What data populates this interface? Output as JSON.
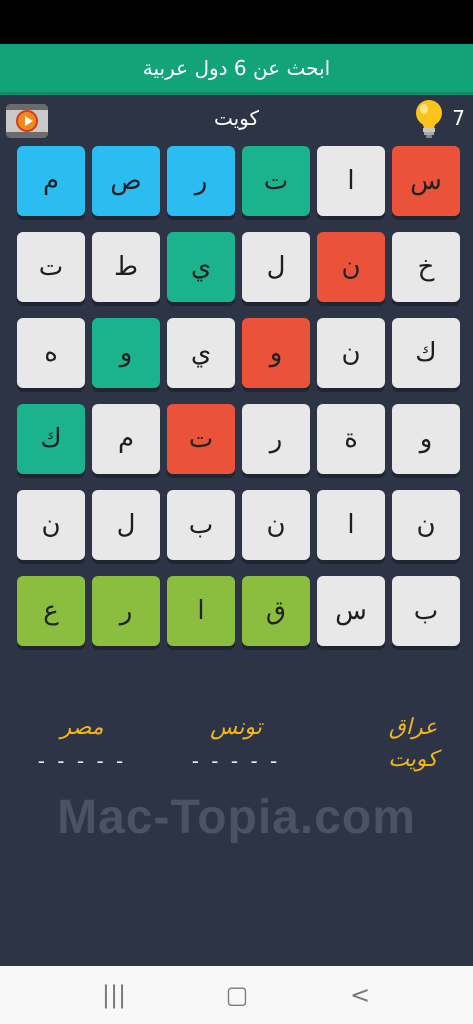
{
  "title": "ابحث عن 6 دول عربية",
  "toolbar": {
    "current_word": "كويت",
    "hint_count": "7",
    "video_icon": "video-play-icon",
    "hint_icon": "lightbulb-icon"
  },
  "grid": {
    "rows": [
      [
        {
          "letter": "س",
          "color": "red"
        },
        {
          "letter": "ا",
          "color": "white"
        },
        {
          "letter": "ت",
          "color": "teal"
        },
        {
          "letter": "ر",
          "color": "blue"
        },
        {
          "letter": "ص",
          "color": "blue"
        },
        {
          "letter": "م",
          "color": "blue"
        }
      ],
      [
        {
          "letter": "خ",
          "color": "white"
        },
        {
          "letter": "ن",
          "color": "red"
        },
        {
          "letter": "ل",
          "color": "white"
        },
        {
          "letter": "ي",
          "color": "teal"
        },
        {
          "letter": "ط",
          "color": "white"
        },
        {
          "letter": "ت",
          "color": "white"
        }
      ],
      [
        {
          "letter": "ك",
          "color": "white"
        },
        {
          "letter": "ن",
          "color": "white"
        },
        {
          "letter": "و",
          "color": "red"
        },
        {
          "letter": "ي",
          "color": "white"
        },
        {
          "letter": "و",
          "color": "teal"
        },
        {
          "letter": "ه",
          "color": "white"
        }
      ],
      [
        {
          "letter": "و",
          "color": "white"
        },
        {
          "letter": "ة",
          "color": "white"
        },
        {
          "letter": "ر",
          "color": "white"
        },
        {
          "letter": "ت",
          "color": "red"
        },
        {
          "letter": "م",
          "color": "white"
        },
        {
          "letter": "ك",
          "color": "teal"
        }
      ],
      [
        {
          "letter": "ن",
          "color": "white"
        },
        {
          "letter": "ا",
          "color": "white"
        },
        {
          "letter": "ن",
          "color": "white"
        },
        {
          "letter": "ب",
          "color": "white"
        },
        {
          "letter": "ل",
          "color": "white"
        },
        {
          "letter": "ن",
          "color": "white"
        }
      ],
      [
        {
          "letter": "ب",
          "color": "white"
        },
        {
          "letter": "س",
          "color": "white"
        },
        {
          "letter": "ق",
          "color": "green"
        },
        {
          "letter": "ا",
          "color": "green"
        },
        {
          "letter": "ر",
          "color": "green"
        },
        {
          "letter": "ع",
          "color": "green"
        }
      ]
    ]
  },
  "words": {
    "right": {
      "line1": "عراق",
      "line2": "كويت"
    },
    "middle": {
      "line1": "تونس",
      "line2": "- - - - -"
    },
    "left": {
      "line1": "مصر",
      "line2": "- - - - -"
    }
  },
  "watermark": "Mac-Topia.com",
  "navbar": {
    "recent": "|||",
    "home": "▢",
    "back": "<"
  },
  "colors": {
    "background": "#2d3446",
    "title_bar": "#12a37b",
    "white": "#e8e8e8",
    "blue": "#2bbdf2",
    "teal": "#1bb38d",
    "red": "#ea5239",
    "green": "#8bbe3e",
    "found_word": "#f4b516"
  }
}
